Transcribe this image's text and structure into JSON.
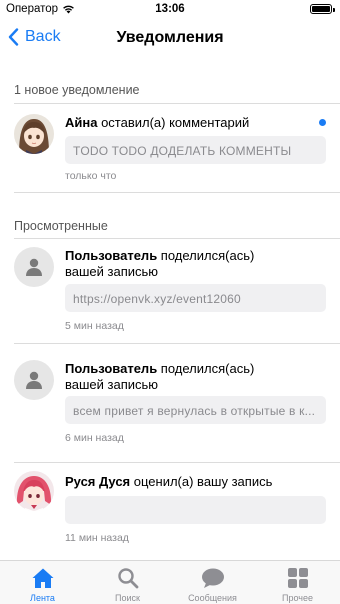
{
  "status_bar": {
    "carrier": "Оператор",
    "time": "13:06"
  },
  "nav": {
    "back_label": "Back",
    "title": "Уведомления"
  },
  "sections": {
    "new_header": "1 новое уведомление",
    "viewed_header": "Просмотренные"
  },
  "notifications": [
    {
      "user": "Айна",
      "action": " оставил(а) комментарий",
      "quote": "TODO  TODO ДОДЕЛАТЬ КОММЕНТЫ",
      "time": "только что",
      "unread": true
    },
    {
      "user": "Пользователь",
      "action": " поделился(ась) вашей записью",
      "quote": "https://openvk.xyz/event12060",
      "time": "5 мин назад"
    },
    {
      "user": "Пользователь",
      "action": " поделился(ась) вашей записью",
      "quote": "всем привет я вернулась в открытые в к...",
      "time": "6 мин назад"
    },
    {
      "user": "Руся Дуся",
      "action": " оценил(а) вашу запись",
      "quote": "",
      "time": "11 мин назад"
    }
  ],
  "tabs": [
    {
      "label": "Лента",
      "icon": "home-icon",
      "active": true
    },
    {
      "label": "Поиск",
      "icon": "search-icon"
    },
    {
      "label": "Сообщения",
      "icon": "chat-bubble-icon"
    },
    {
      "label": "Прочее",
      "icon": "grid-icon"
    }
  ],
  "colors": {
    "accent": "#1a7cf4",
    "quote_bg": "#f0f0f2",
    "secondary_text": "#8a8a8e"
  }
}
